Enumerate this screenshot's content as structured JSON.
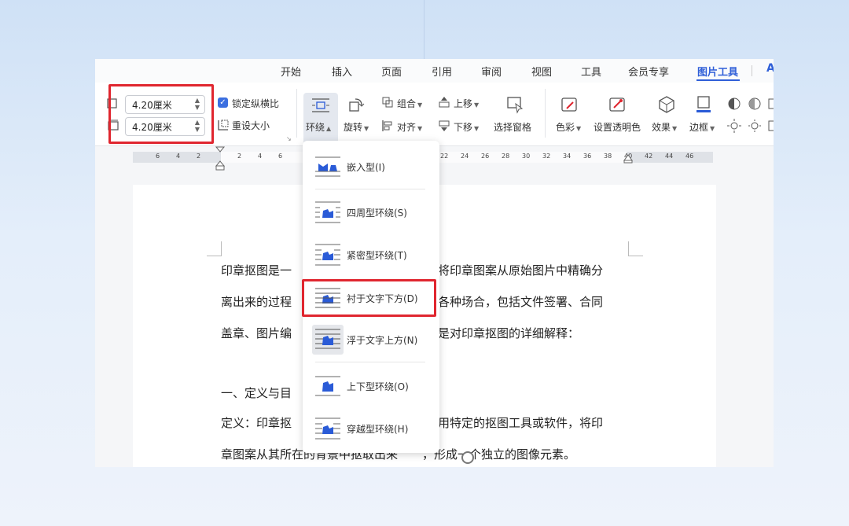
{
  "menu": {
    "items": [
      "开始",
      "插入",
      "页面",
      "引用",
      "审阅",
      "视图",
      "工具",
      "会员专享",
      "图片工具"
    ],
    "active": "图片工具"
  },
  "ribbon": {
    "height_value": "4.20厘米",
    "width_value": "4.20厘米",
    "lock_ratio_label": "锁定纵横比",
    "lock_ratio_checked": true,
    "reset_size_label": "重设大小",
    "wrap_label": "环绕",
    "rotate_label": "旋转",
    "group_label": "组合",
    "align_label": "对齐",
    "bring_up_label": "上移",
    "send_down_label": "下移",
    "selection_pane_label": "选择窗格",
    "color_label": "色彩",
    "transparent_label": "设置透明色",
    "effects_label": "效果",
    "border_label": "边框"
  },
  "ruler": {
    "ticks": [
      "6",
      "4",
      "2",
      "2",
      "4",
      "6",
      "22",
      "24",
      "26",
      "28",
      "30",
      "32",
      "34",
      "36",
      "38",
      "40",
      "42",
      "44",
      "46"
    ]
  },
  "wrap_menu": {
    "items": [
      {
        "label": "嵌入型(I)",
        "icon": "inline-wrap-icon"
      },
      {
        "label": "四周型环绕(S)",
        "icon": "square-wrap-icon"
      },
      {
        "label": "紧密型环绕(T)",
        "icon": "tight-wrap-icon"
      },
      {
        "label": "衬于文字下方(D)",
        "icon": "behind-text-icon"
      },
      {
        "label": "浮于文字上方(N)",
        "icon": "in-front-text-icon"
      },
      {
        "label": "上下型环绕(O)",
        "icon": "top-bottom-wrap-icon"
      },
      {
        "label": "穿越型环绕(H)",
        "icon": "through-wrap-icon"
      }
    ],
    "highlighted": "衬于文字下方(D)",
    "selected": "浮于文字上方(N)"
  },
  "document": {
    "lines": [
      {
        "left": "印章抠图是一",
        "right": "将印章图案从原始图片中精确分"
      },
      {
        "left": "离出来的过程",
        "right": "各种场合，包括文件签署、合同"
      },
      {
        "left": "盖章、图片编",
        "right": "是对印章抠图的详细解释："
      },
      {
        "left": "",
        "right": ""
      },
      {
        "left": "一、定义与目",
        "right": ""
      },
      {
        "left": "定义：印章抠",
        "right": "用特定的抠图工具或软件，将印"
      },
      {
        "left": "章图案从其所在的背景中抠取出来",
        "right": "，形成一个独立的图像元素。"
      }
    ]
  },
  "colors": {
    "accent": "#2f5fd8",
    "highlight_red": "#e0262f",
    "icon_blue": "#2a5bd7"
  }
}
